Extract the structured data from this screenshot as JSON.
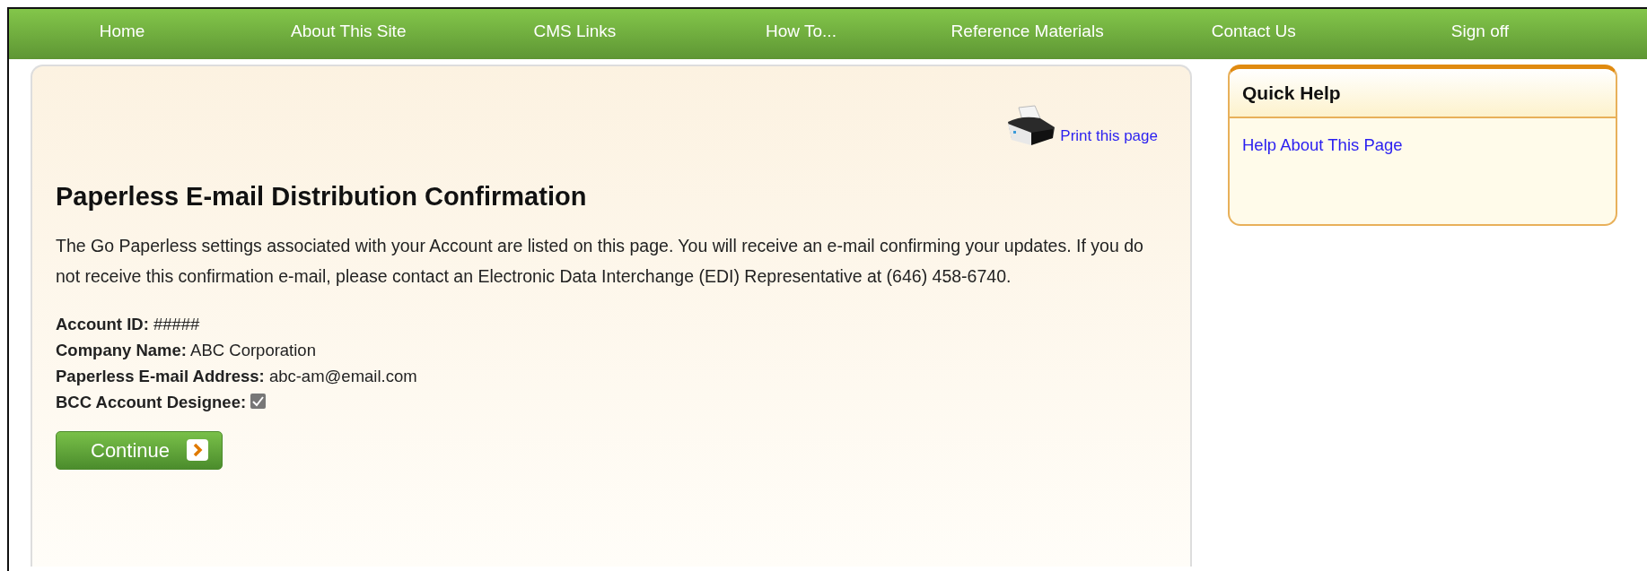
{
  "nav": [
    {
      "label": "Home"
    },
    {
      "label": "About This Site"
    },
    {
      "label": "CMS Links"
    },
    {
      "label": "How To..."
    },
    {
      "label": "Reference Materials"
    },
    {
      "label": "Contact Us"
    },
    {
      "label": "Sign off"
    }
  ],
  "main": {
    "print_link": "Print this page",
    "title": "Paperless E-mail Distribution Confirmation",
    "intro": "The Go Paperless settings associated with your Account are listed on this page. You will receive an e-mail confirming your updates. If you do not receive this confirmation e-mail, please contact an Electronic Data Interchange (EDI) Representative at (646) 458-6740.",
    "fields": [
      {
        "kind": "text",
        "label": "Account ID:",
        "value": "#####"
      },
      {
        "kind": "text",
        "label": "Company Name:",
        "value": "ABC Corporation"
      },
      {
        "kind": "text",
        "label": "Paperless E-mail Address:",
        "value": "abc-am@email.com"
      },
      {
        "kind": "checkbox",
        "label": "BCC Account Designee:",
        "checked": true
      }
    ],
    "button": "Continue"
  },
  "quick_help": {
    "title": "Quick Help",
    "links": [
      "Help About This Page"
    ]
  }
}
